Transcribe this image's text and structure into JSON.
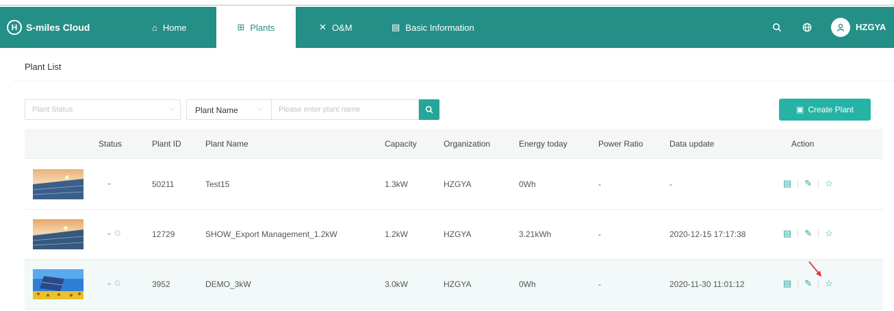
{
  "navbar": {
    "brand": "S-miles Cloud",
    "brand_mark": "H",
    "items": [
      {
        "label": "Home",
        "icon": "home-icon"
      },
      {
        "label": "Plants",
        "icon": "plants-icon",
        "active": true
      },
      {
        "label": "O&M",
        "icon": "tools-icon"
      },
      {
        "label": "Basic Information",
        "icon": "document-icon"
      }
    ],
    "username": "HZGYA"
  },
  "page": {
    "title": "Plant List"
  },
  "filters": {
    "status_placeholder": "Plant Status",
    "name_field_label": "Plant Name",
    "name_placeholder": "Please enter plant name",
    "create_label": "Create Plant"
  },
  "table": {
    "headers": [
      "Status",
      "Plant ID",
      "Plant Name",
      "Capacity",
      "Organization",
      "Energy today",
      "Power Ratio",
      "Data update",
      "Action"
    ],
    "rows": [
      {
        "plant_id": "50211",
        "plant_name": "Test15",
        "capacity": "1.3kW",
        "organization": "HZGYA",
        "energy_today": "0Wh",
        "power_ratio": "-",
        "data_update": "-",
        "status_online": false
      },
      {
        "plant_id": "12729",
        "plant_name": "SHOW_Export Management_1.2kW",
        "capacity": "1.2kW",
        "organization": "HZGYA",
        "energy_today": "3.21kWh",
        "power_ratio": "-",
        "data_update": "2020-12-15 17:17:38",
        "status_online": true
      },
      {
        "plant_id": "3952",
        "plant_name": "DEMO_3kW",
        "capacity": "3.0kW",
        "organization": "HZGYA",
        "energy_today": "0Wh",
        "power_ratio": "-",
        "data_update": "2020-11-30 11:01:12",
        "status_online": true
      }
    ]
  },
  "colors": {
    "brand": "#238f87",
    "accent": "#26a69a",
    "annotation_arrow": "#e53935"
  }
}
